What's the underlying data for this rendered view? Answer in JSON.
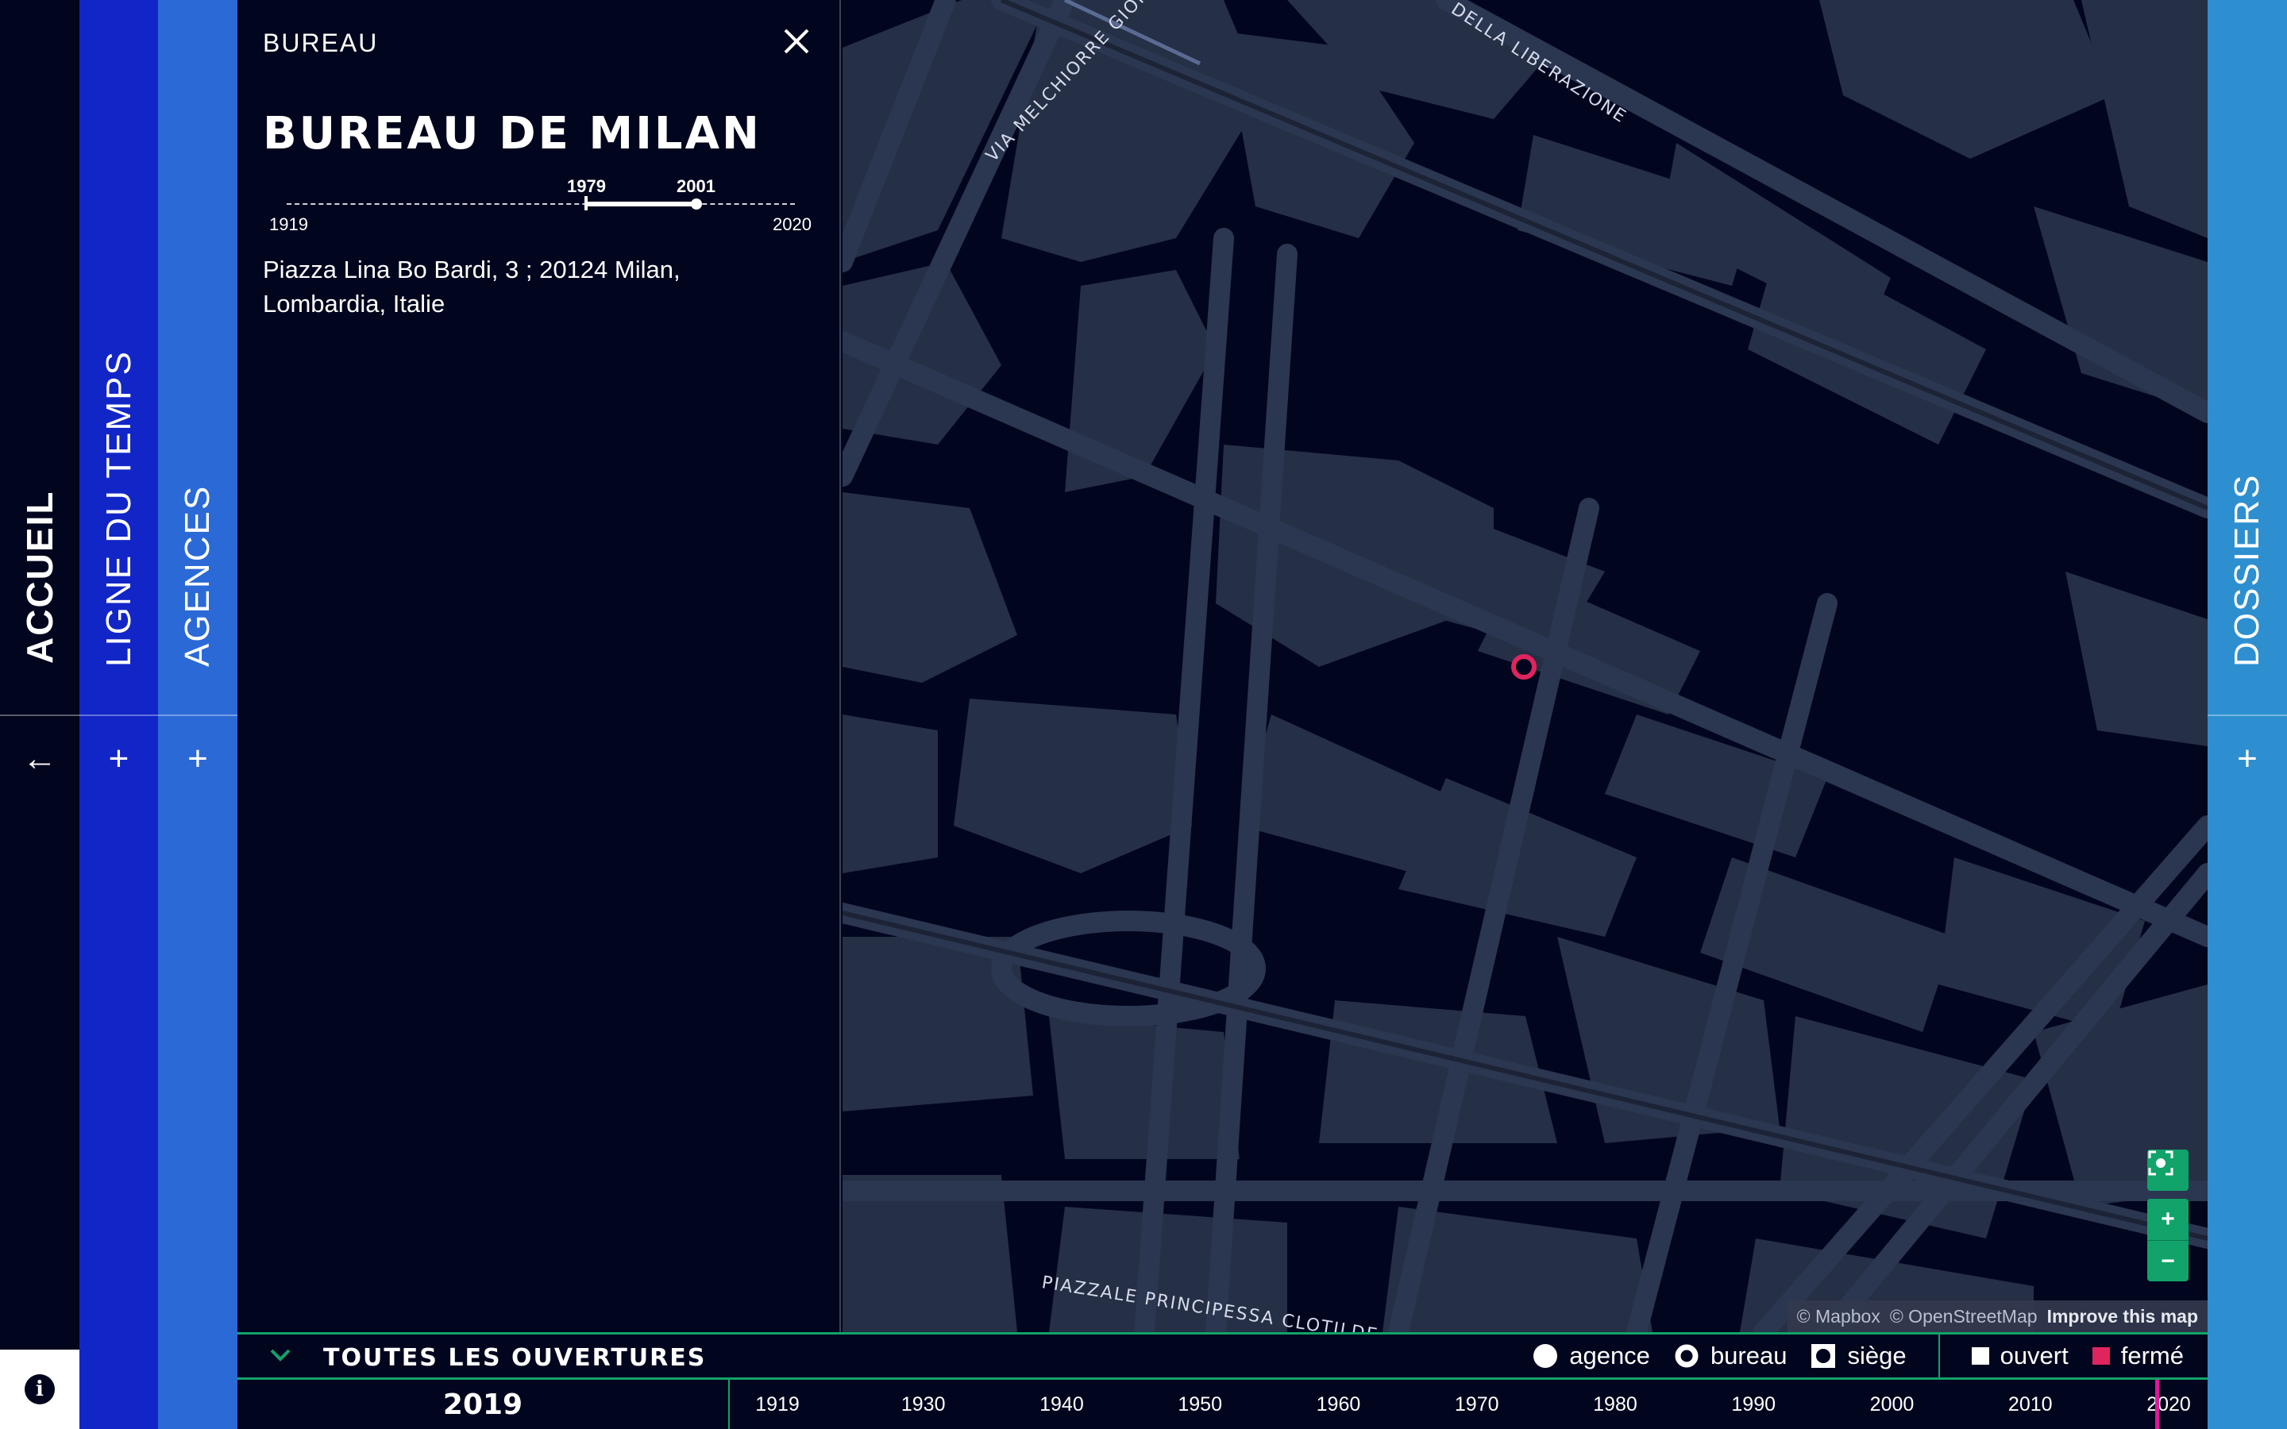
{
  "nav": {
    "home": {
      "label": "ACCUEIL",
      "action_icon": "arrow-left-icon"
    },
    "timeline": {
      "label": "LIGNE DU TEMPS",
      "action_icon": "plus-icon"
    },
    "agencies": {
      "label": "AGENCES",
      "action_icon": "plus-icon"
    },
    "dossiers": {
      "label": "DOSSIERS",
      "action_icon": "plus-icon"
    },
    "info_icon": "info-icon",
    "arrow_glyph": "←",
    "plus_glyph": "+",
    "info_glyph": "i"
  },
  "panel": {
    "kicker": "BUREAU",
    "title": "BUREAU DE MILAN",
    "span": {
      "min_year": "1919",
      "max_year": "2020",
      "start": "1979",
      "end": "2001"
    },
    "address": "Piazza Lina Bo Bardi, 3 ; 20124 Milan, Lombardia, Italie"
  },
  "map": {
    "labels": {
      "street_1": "VIA MELCHIORRE GIOIA",
      "street_2": "DELLA LIBERAZIONE",
      "street_3": "PIAZZALE PRINCIPESSA CLOTILDE"
    },
    "marker_color": "#e0245e",
    "controls": {
      "recenter_icon": "fullscreen-icon",
      "zoom_in": "+",
      "zoom_out": "−"
    },
    "attribution": {
      "mapbox": "© Mapbox",
      "osm": "© OpenStreetMap",
      "improve": "Improve this map"
    }
  },
  "legend": {
    "title": "TOUTES LES OUVERTURES",
    "items": [
      "agence",
      "bureau",
      "siège"
    ],
    "status": [
      "ouvert",
      "fermé"
    ],
    "status_colors": {
      "ouvert": "#ffffff",
      "fermé": "#e0245e"
    }
  },
  "timeline": {
    "current_year": "2019",
    "decades": [
      "1919",
      "1930",
      "1940",
      "1950",
      "1960",
      "1970",
      "1980",
      "1990",
      "2000",
      "2010",
      "2020"
    ],
    "range": [
      1919,
      2020
    ],
    "cursor_year": 2019,
    "cursor_color": "#e0179a"
  },
  "colors": {
    "background": "#02051e",
    "accent": "#11a36a",
    "nav_blue": "#1226c7",
    "agencies_blue": "#2b69d6",
    "dossiers_blue": "#2e8fd0"
  }
}
